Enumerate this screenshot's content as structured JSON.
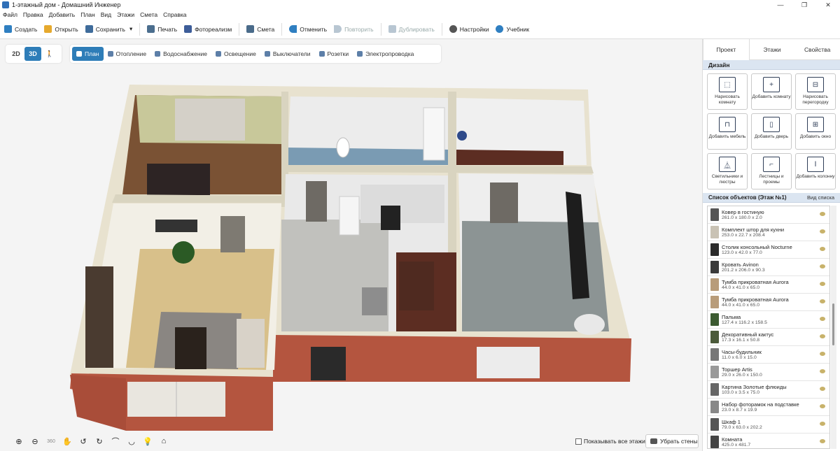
{
  "window": {
    "title": "1-этажный дом - Домашний Инженер",
    "buttons": [
      "—",
      "❐",
      "✕"
    ]
  },
  "menu": [
    "Файл",
    "Правка",
    "Добавить",
    "План",
    "Вид",
    "Этажи",
    "Смета",
    "Справка"
  ],
  "toolbar": {
    "create": "Создать",
    "open": "Открыть",
    "save": "Сохранить",
    "save_arrow": "▾",
    "print": "Печать",
    "photo": "Фотореализм",
    "estimate": "Смета",
    "undo": "Отменить",
    "redo": "Повторить",
    "duplicate": "Дублировать",
    "settings": "Настройки",
    "tutorial": "Учебник"
  },
  "view_toggle": {
    "d2": "2D",
    "d3": "3D",
    "walk": "🚶",
    "active": "3D"
  },
  "modes": [
    "План",
    "Отопление",
    "Водоснабжение",
    "Освещение",
    "Выключатели",
    "Розетки",
    "Электропроводка"
  ],
  "active_mode": "План",
  "bottom": {
    "nav_icons": [
      "zoom-in-icon",
      "zoom-out-icon",
      "rotate-360-icon",
      "pan-hand-icon",
      "rotate-left-icon",
      "rotate-right-icon",
      "tilt-up-icon",
      "tilt-down-icon",
      "light-icon",
      "home-icon"
    ],
    "nav_glyphs": [
      "⊕",
      "⊖",
      "360",
      "✋",
      "↺",
      "↻",
      "⌒",
      "◡",
      "💡",
      "⌂"
    ],
    "all_floors": "Показывать все этажи",
    "remove_walls": "Убрать стены"
  },
  "panel": {
    "tabs": [
      "Проект",
      "Этажи",
      "Свойства"
    ],
    "active_tab": "Проект",
    "design_header": "Дизайн",
    "tiles": [
      {
        "label": "Нарисовать комнату",
        "glyph": "⬚"
      },
      {
        "label": "Добавить комнату",
        "glyph": "+"
      },
      {
        "label": "Нарисовать перегородку",
        "glyph": "⊟"
      },
      {
        "label": "Добавить мебель",
        "glyph": "⊓"
      },
      {
        "label": "Добавить дверь",
        "glyph": "▯"
      },
      {
        "label": "Добавить окно",
        "glyph": "⊞"
      },
      {
        "label": "Светильники и люстры",
        "glyph": "⏅"
      },
      {
        "label": "Лестницы и проемы",
        "glyph": "⌐"
      },
      {
        "label": "Добавить колонну",
        "glyph": "Ⅰ"
      }
    ],
    "objects_header": "Список объектов (Этаж №1)",
    "view_list": "Вид списка",
    "objects": [
      {
        "name": "Ковер в гостиную",
        "dims": "261.0 x 180.0 x 2.0"
      },
      {
        "name": "Комплект штор для кухни",
        "dims": "253.0 x 22.7 x 208.4"
      },
      {
        "name": "Столик консольный Nocturne",
        "dims": "123.0 x 42.0 x 77.0"
      },
      {
        "name": "Кровать Avinon",
        "dims": "201.2 x 206.0 x 90.3"
      },
      {
        "name": "Тумба прикроватная Aurora",
        "dims": "44.0 x 41.0 x 65.0"
      },
      {
        "name": "Тумба прикроватная Aurora",
        "dims": "44.0 x 41.0 x 65.0"
      },
      {
        "name": "Пальма",
        "dims": "127.4 x 116.2 x 158.5"
      },
      {
        "name": "Декоративный кактус",
        "dims": "17.3 x 16.1 x 50.8"
      },
      {
        "name": "Часы-будильник",
        "dims": "11.0 x 6.0 x 15.0"
      },
      {
        "name": "Торшер Artis",
        "dims": "29.0 x 26.0 x 150.0"
      },
      {
        "name": "Картина Золотые флюиды",
        "dims": "103.0 x 3.5 x 75.0"
      },
      {
        "name": "Набор фоторамок на подставке",
        "dims": "23.0 x 8.7 x 19.9"
      },
      {
        "name": "Шкаф 1",
        "dims": "79.0 x 63.0 x 202.2"
      },
      {
        "name": "Комната",
        "dims": "425.0 x 481.7"
      }
    ]
  },
  "colors": {
    "accent": "#2e7db8",
    "brick": "#b4553f",
    "panel_header": "#dbe5f1"
  }
}
